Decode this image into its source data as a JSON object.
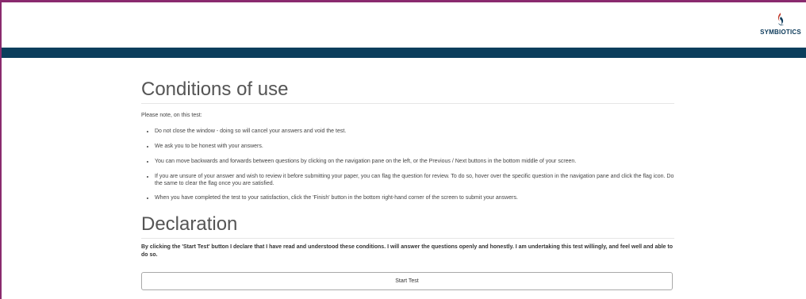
{
  "brand": {
    "name": "SYMBIOTICS",
    "colors": {
      "frame": "#8a2a6e",
      "navbar": "#0b3e5c",
      "logo_red": "#c23a2b",
      "logo_navy": "#0c3a5a"
    }
  },
  "conditions": {
    "title": "Conditions of use",
    "intro": "Please note, on this test:",
    "items": [
      "Do not close the window - doing so will cancel your answers and void the test.",
      "We ask you to be honest with your answers.",
      "You can move backwards and forwards between questions by clicking on the navigation pane on the left, or the Previous / Next buttons in the bottom middle of your screen.",
      "If you are unsure of your answer and wish to review it before submitting your paper, you can flag the question for review. To do so, hover over the specific question in the navigation pane and click the flag icon. Do the same to clear the flag once you are satisfied.",
      "When you have completed the test to your satisfaction, click the 'Finish' button in the bottom right-hand corner of the screen to submit your answers."
    ]
  },
  "declaration": {
    "title": "Declaration",
    "text": "By clicking the 'Start Test' button I declare that I have read and understood these conditions. I will answer the questions openly and honestly. I am undertaking this test willingly, and feel well and able to do so.",
    "button_label": "Start Test"
  }
}
